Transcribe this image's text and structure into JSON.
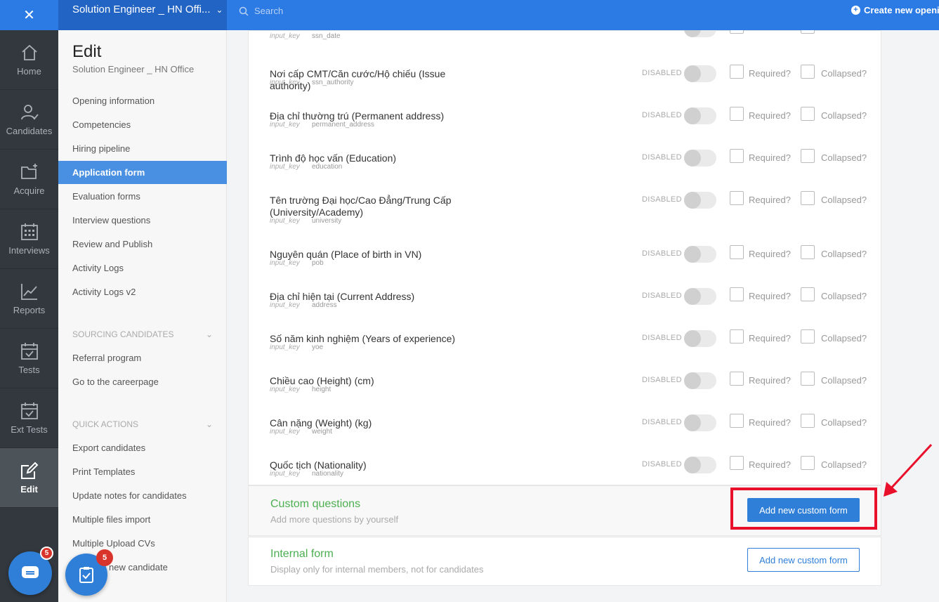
{
  "topbar": {
    "job_title": "Solution Engineer _ HN Offi...",
    "search_placeholder": "Search",
    "create_label": "Create new openin"
  },
  "rail": [
    {
      "label": "Home",
      "icon": "home-icon"
    },
    {
      "label": "Candidates",
      "icon": "candidates-icon"
    },
    {
      "label": "Acquire",
      "icon": "folder-plus-icon"
    },
    {
      "label": "Interviews",
      "icon": "calendar-grid-icon"
    },
    {
      "label": "Reports",
      "icon": "chart-line-icon"
    },
    {
      "label": "Tests",
      "icon": "calendar-check-icon"
    },
    {
      "label": "Ext Tests",
      "icon": "calendar-check-icon"
    },
    {
      "label": "Edit",
      "icon": "edit-icon"
    }
  ],
  "chat_badge": "5",
  "subnav": {
    "title": "Edit",
    "subtitle": "Solution Engineer _ HN Office",
    "links": [
      "Opening information",
      "Competencies",
      "Hiring pipeline",
      "Application form",
      "Evaluation forms",
      "Interview questions",
      "Review and Publish",
      "Activity Logs",
      "Activity Logs v2"
    ],
    "active": "Application form",
    "sourcing_header": "SOURCING CANDIDATES",
    "sourcing_links": [
      "Referral program",
      "Go to the careerpage"
    ],
    "quick_header": "QUICK ACTIONS",
    "quick_links": [
      "Export candidates",
      "Print Templates",
      "Update notes for candidates",
      "Multiple files import",
      "Multiple Upload CVs",
      "new candidate"
    ],
    "fab_badge": "5"
  },
  "fields": {
    "disabled_text": "DISABLED",
    "required_text": "Required?",
    "collapsed_text": "Collapsed?",
    "key_label": "input_key",
    "top_partial_key": "ssn_date",
    "items": [
      {
        "label": "Nơi cấp CMT/Căn cước/Hộ chiếu (Issue authority)",
        "key": "ssn_authority"
      },
      {
        "label": "Địa chỉ thường trú (Permanent address)",
        "key": "permanent_address"
      },
      {
        "label": "Trình độ học vấn (Education)",
        "key": "education"
      },
      {
        "label": "Tên trường Đại học/Cao Đẳng/Trung Cấp (University/Academy)",
        "key": "university"
      },
      {
        "label": "Nguyên quán (Place of birth in VN)",
        "key": "pob"
      },
      {
        "label": "Địa chỉ hiện tại (Current Address)",
        "key": "address"
      },
      {
        "label": "Số năm kinh nghiệm (Years of experience)",
        "key": "yoe"
      },
      {
        "label": "Chiều cao (Height) (cm)",
        "key": "height"
      },
      {
        "label": "Cân nặng (Weight) (kg)",
        "key": "weight"
      },
      {
        "label": "Quốc tịch (Nationality)",
        "key": "nationality"
      }
    ]
  },
  "custom_questions": {
    "title": "Custom questions",
    "subtitle": "Add more questions by yourself",
    "button": "Add new custom form"
  },
  "internal_form": {
    "title": "Internal form",
    "subtitle": "Display only for internal members, not for candidates",
    "button": "Add new custom form"
  },
  "colors": {
    "primary": "#2f7fd8",
    "accent_green": "#4caf50",
    "highlight_red": "#e8102b"
  }
}
